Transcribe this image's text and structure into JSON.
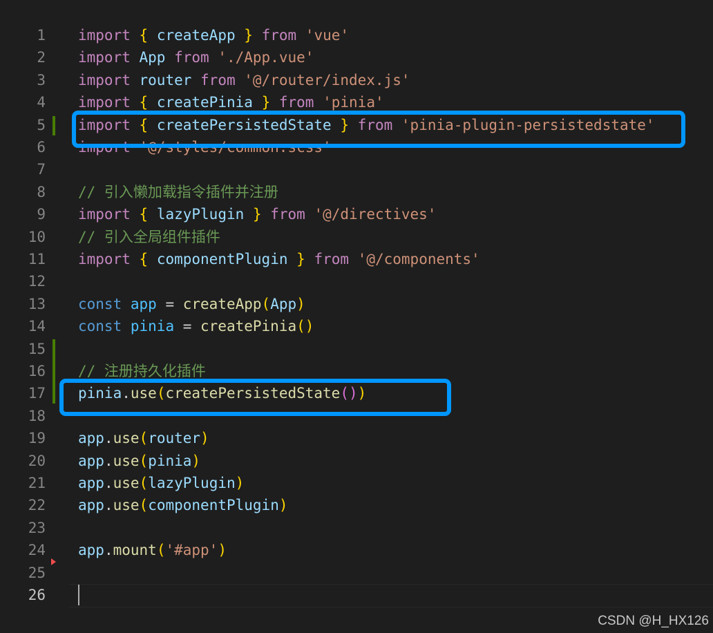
{
  "editor": {
    "current_line": 26,
    "lines": [
      {
        "n": "1",
        "tokens": [
          {
            "t": "import",
            "c": "kw"
          },
          {
            "t": " ",
            "c": "p"
          },
          {
            "t": "{",
            "c": "b1"
          },
          {
            "t": " ",
            "c": "p"
          },
          {
            "t": "createApp",
            "c": "var"
          },
          {
            "t": " ",
            "c": "p"
          },
          {
            "t": "}",
            "c": "b1"
          },
          {
            "t": " ",
            "c": "p"
          },
          {
            "t": "from",
            "c": "kw"
          },
          {
            "t": " ",
            "c": "p"
          },
          {
            "t": "'vue'",
            "c": "str"
          }
        ]
      },
      {
        "n": "2",
        "tokens": [
          {
            "t": "import",
            "c": "kw"
          },
          {
            "t": " ",
            "c": "p"
          },
          {
            "t": "App",
            "c": "var"
          },
          {
            "t": " ",
            "c": "p"
          },
          {
            "t": "from",
            "c": "kw"
          },
          {
            "t": " ",
            "c": "p"
          },
          {
            "t": "'./App.vue'",
            "c": "str"
          }
        ]
      },
      {
        "n": "3",
        "tokens": [
          {
            "t": "import",
            "c": "kw"
          },
          {
            "t": " ",
            "c": "p"
          },
          {
            "t": "router",
            "c": "var"
          },
          {
            "t": " ",
            "c": "p"
          },
          {
            "t": "from",
            "c": "kw"
          },
          {
            "t": " ",
            "c": "p"
          },
          {
            "t": "'@/router/index.js'",
            "c": "str"
          }
        ]
      },
      {
        "n": "4",
        "tokens": [
          {
            "t": "import",
            "c": "kw"
          },
          {
            "t": " ",
            "c": "p"
          },
          {
            "t": "{",
            "c": "b1"
          },
          {
            "t": " ",
            "c": "p"
          },
          {
            "t": "createPinia",
            "c": "var"
          },
          {
            "t": " ",
            "c": "p"
          },
          {
            "t": "}",
            "c": "b1"
          },
          {
            "t": " ",
            "c": "p"
          },
          {
            "t": "from",
            "c": "kw"
          },
          {
            "t": " ",
            "c": "p"
          },
          {
            "t": "'pinia'",
            "c": "str"
          }
        ]
      },
      {
        "n": "5",
        "tokens": [
          {
            "t": "import",
            "c": "kw"
          },
          {
            "t": " ",
            "c": "p"
          },
          {
            "t": "{",
            "c": "b1"
          },
          {
            "t": " ",
            "c": "p"
          },
          {
            "t": "createPersistedState",
            "c": "var"
          },
          {
            "t": " ",
            "c": "p"
          },
          {
            "t": "}",
            "c": "b1"
          },
          {
            "t": " ",
            "c": "p"
          },
          {
            "t": "from",
            "c": "kw"
          },
          {
            "t": " ",
            "c": "p"
          },
          {
            "t": "'pinia-plugin-persistedstate'",
            "c": "str"
          }
        ]
      },
      {
        "n": "6",
        "tokens": [
          {
            "t": "import",
            "c": "kw"
          },
          {
            "t": " ",
            "c": "p"
          },
          {
            "t": "'@/styles/common.scss'",
            "c": "str"
          }
        ]
      },
      {
        "n": "7",
        "tokens": []
      },
      {
        "n": "8",
        "tokens": [
          {
            "t": "// 引入懒加载指令插件并注册",
            "c": "cm"
          }
        ]
      },
      {
        "n": "9",
        "tokens": [
          {
            "t": "import",
            "c": "kw"
          },
          {
            "t": " ",
            "c": "p"
          },
          {
            "t": "{",
            "c": "b1"
          },
          {
            "t": " ",
            "c": "p"
          },
          {
            "t": "lazyPlugin",
            "c": "var"
          },
          {
            "t": " ",
            "c": "p"
          },
          {
            "t": "}",
            "c": "b1"
          },
          {
            "t": " ",
            "c": "p"
          },
          {
            "t": "from",
            "c": "kw"
          },
          {
            "t": " ",
            "c": "p"
          },
          {
            "t": "'@/directives'",
            "c": "str"
          }
        ]
      },
      {
        "n": "10",
        "tokens": [
          {
            "t": "// 引入全局组件插件",
            "c": "cm"
          }
        ]
      },
      {
        "n": "11",
        "tokens": [
          {
            "t": "import",
            "c": "kw"
          },
          {
            "t": " ",
            "c": "p"
          },
          {
            "t": "{",
            "c": "b1"
          },
          {
            "t": " ",
            "c": "p"
          },
          {
            "t": "componentPlugin",
            "c": "var"
          },
          {
            "t": " ",
            "c": "p"
          },
          {
            "t": "}",
            "c": "b1"
          },
          {
            "t": " ",
            "c": "p"
          },
          {
            "t": "from",
            "c": "kw"
          },
          {
            "t": " ",
            "c": "p"
          },
          {
            "t": "'@/components'",
            "c": "str"
          }
        ]
      },
      {
        "n": "12",
        "tokens": []
      },
      {
        "n": "13",
        "tokens": [
          {
            "t": "const",
            "c": "kwd"
          },
          {
            "t": " ",
            "c": "p"
          },
          {
            "t": "app",
            "c": "const"
          },
          {
            "t": " = ",
            "c": "p"
          },
          {
            "t": "createApp",
            "c": "fn"
          },
          {
            "t": "(",
            "c": "b1"
          },
          {
            "t": "App",
            "c": "var"
          },
          {
            "t": ")",
            "c": "b1"
          }
        ]
      },
      {
        "n": "14",
        "tokens": [
          {
            "t": "const",
            "c": "kwd"
          },
          {
            "t": " ",
            "c": "p"
          },
          {
            "t": "pinia",
            "c": "const"
          },
          {
            "t": " = ",
            "c": "p"
          },
          {
            "t": "createPinia",
            "c": "fn"
          },
          {
            "t": "()",
            "c": "b1"
          }
        ]
      },
      {
        "n": "15",
        "tokens": []
      },
      {
        "n": "16",
        "tokens": [
          {
            "t": "// 注册持久化插件",
            "c": "cm"
          }
        ]
      },
      {
        "n": "17",
        "tokens": [
          {
            "t": "pinia",
            "c": "var"
          },
          {
            "t": ".",
            "c": "p"
          },
          {
            "t": "use",
            "c": "fn"
          },
          {
            "t": "(",
            "c": "b1"
          },
          {
            "t": "createPersistedState",
            "c": "fn"
          },
          {
            "t": "()",
            "c": "b2"
          },
          {
            "t": ")",
            "c": "b1"
          }
        ]
      },
      {
        "n": "18",
        "tokens": []
      },
      {
        "n": "19",
        "tokens": [
          {
            "t": "app",
            "c": "var"
          },
          {
            "t": ".",
            "c": "p"
          },
          {
            "t": "use",
            "c": "fn"
          },
          {
            "t": "(",
            "c": "b1"
          },
          {
            "t": "router",
            "c": "var"
          },
          {
            "t": ")",
            "c": "b1"
          }
        ]
      },
      {
        "n": "20",
        "tokens": [
          {
            "t": "app",
            "c": "var"
          },
          {
            "t": ".",
            "c": "p"
          },
          {
            "t": "use",
            "c": "fn"
          },
          {
            "t": "(",
            "c": "b1"
          },
          {
            "t": "pinia",
            "c": "var"
          },
          {
            "t": ")",
            "c": "b1"
          }
        ]
      },
      {
        "n": "21",
        "tokens": [
          {
            "t": "app",
            "c": "var"
          },
          {
            "t": ".",
            "c": "p"
          },
          {
            "t": "use",
            "c": "fn"
          },
          {
            "t": "(",
            "c": "b1"
          },
          {
            "t": "lazyPlugin",
            "c": "var"
          },
          {
            "t": ")",
            "c": "b1"
          }
        ]
      },
      {
        "n": "22",
        "tokens": [
          {
            "t": "app",
            "c": "var"
          },
          {
            "t": ".",
            "c": "p"
          },
          {
            "t": "use",
            "c": "fn"
          },
          {
            "t": "(",
            "c": "b1"
          },
          {
            "t": "componentPlugin",
            "c": "var"
          },
          {
            "t": ")",
            "c": "b1"
          }
        ]
      },
      {
        "n": "23",
        "tokens": []
      },
      {
        "n": "24",
        "tokens": [
          {
            "t": "app",
            "c": "var"
          },
          {
            "t": ".",
            "c": "p"
          },
          {
            "t": "mount",
            "c": "fn"
          },
          {
            "t": "(",
            "c": "b1"
          },
          {
            "t": "'#app'",
            "c": "str"
          },
          {
            "t": ")",
            "c": "b1"
          }
        ]
      },
      {
        "n": "25",
        "tokens": []
      },
      {
        "n": "26",
        "tokens": []
      }
    ]
  },
  "colors": {
    "background": "#1e1e1e",
    "highlight_box": "#0096ff",
    "git_added": "#487e02",
    "git_deleted": "#f14c4c"
  },
  "watermark": "CSDN @H_HX126"
}
